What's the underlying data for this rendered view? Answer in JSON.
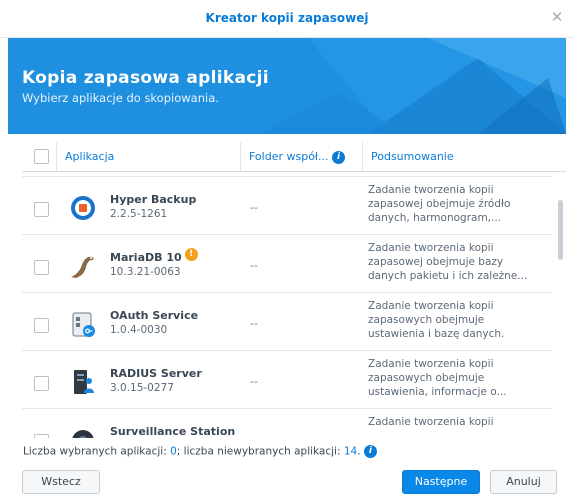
{
  "window": {
    "title": "Kreator kopii zapasowej"
  },
  "banner": {
    "title": "Kopia zapasowa aplikacji",
    "subtitle": "Wybierz aplikacje do skopiowania."
  },
  "table": {
    "columns": [
      "Aplikacja",
      "Folder współ...",
      "Podsumowanie"
    ],
    "rows": [
      {
        "name": "Hyper Backup",
        "version": "2.2.5-1261",
        "folder": "--",
        "summary": "Zadanie tworzenia kopii zapasowej obejmuje źródło danych, harmonogram,...",
        "icon": "hyper-backup-icon",
        "warning": false
      },
      {
        "name": "MariaDB 10",
        "version": "10.3.21-0063",
        "folder": "--",
        "summary": "Zadanie tworzenia kopii zapasowej obejmuje bazy danych pakietu i ich zależne...",
        "icon": "mariadb-seal-icon",
        "warning": true
      },
      {
        "name": "OAuth Service",
        "version": "1.0.4-0030",
        "folder": "--",
        "summary": "Zadanie tworzenia kopii zapasowych obejmuje ustawienia i bazę danych.",
        "icon": "oauth-service-icon",
        "warning": false
      },
      {
        "name": "RADIUS Server",
        "version": "3.0.15-0277",
        "folder": "--",
        "summary": "Zadanie tworzenia kopii zapasowych obejmuje ustawienia, informacje o...",
        "icon": "radius-server-icon",
        "warning": false
      },
      {
        "name": "Surveillance Station",
        "version": "",
        "folder": "",
        "summary": "Zadanie tworzenia kopii",
        "icon": "surveillance-station-icon",
        "warning": false
      }
    ]
  },
  "footer": {
    "selected_label": "Liczba wybranych aplikacji:",
    "selected_count": "0",
    "unselected_label": "; liczba niewybranych aplikacji:",
    "unselected_count": "14",
    "suffix": "."
  },
  "buttons": {
    "back": "Wstecz",
    "next": "Następne",
    "cancel": "Anuluj"
  },
  "colors": {
    "accent": "#0a7cd6",
    "banner": "#1f8fe0",
    "warning": "#f5a01a"
  }
}
